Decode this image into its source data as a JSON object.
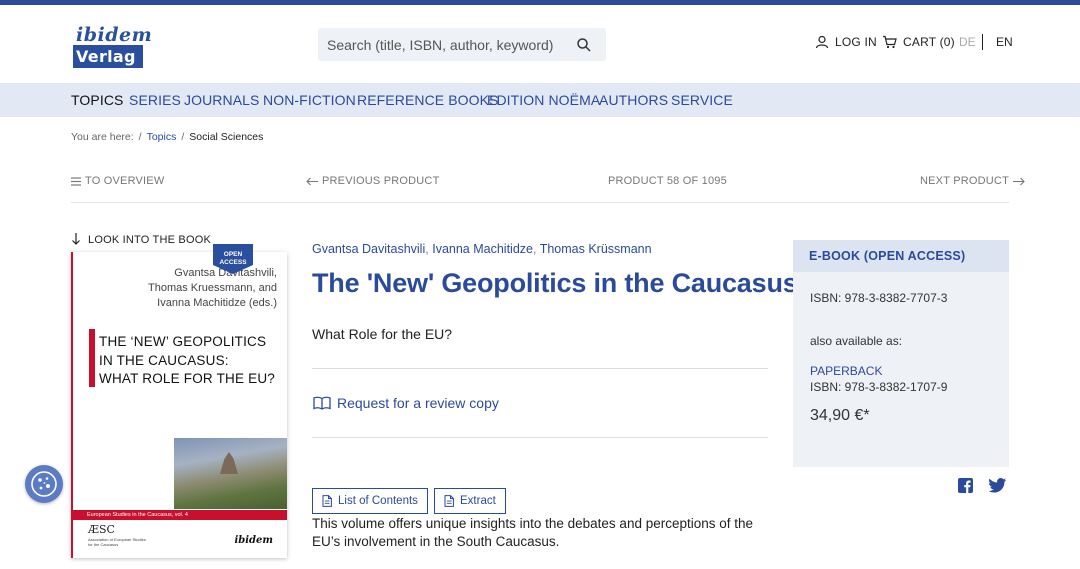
{
  "colors": {
    "brand_blue": "#2b4a9b",
    "nav_bg": "#e3e9f4",
    "accent_red": "#c8102e",
    "box_bg": "#eef1f6"
  },
  "logo": {
    "line1": "ibidem",
    "line2": "Verlag"
  },
  "search": {
    "placeholder": "Search (title, ISBN, author, keyword)",
    "icon": "search-icon"
  },
  "header": {
    "login": "LOG IN",
    "cart": "CART (0)",
    "lang_de": "DE",
    "lang_en": "EN"
  },
  "nav": {
    "items": [
      {
        "label": "TOPICS"
      },
      {
        "label": "SERIES"
      },
      {
        "label": "JOURNALS"
      },
      {
        "label": "NON-FICTION"
      },
      {
        "label": "REFERENCE BOOKS"
      },
      {
        "label": "EDITION NOËMA"
      },
      {
        "label": "AUTHORS"
      },
      {
        "label": "SERVICE"
      }
    ]
  },
  "breadcrumb": {
    "prefix": "You are here:",
    "sep": "/",
    "topics": "Topics",
    "current": "Social Sciences"
  },
  "pager": {
    "overview": "TO OVERVIEW",
    "previous": "PREVIOUS PRODUCT",
    "position": "PRODUCT 58 OF 1095",
    "next": "NEXT PRODUCT"
  },
  "cover": {
    "look_label": "LOOK INTO THE BOOK",
    "badge_line1": "OPEN",
    "badge_line2": "ACCESS",
    "authors_line1": "Gvantsa Davitashvili,",
    "authors_line2": "Thomas Kruessmann, and",
    "authors_line3": "Ivanna Machitidze (eds.)",
    "title_line1": "THE ‘NEW’ GEOPOLITICS",
    "title_line2": "IN THE CAUCASUS:",
    "title_line3": "WHAT ROLE FOR THE EU?",
    "series": "European Studies in the Caucasus, vol. 4",
    "aesc": "ÆSC",
    "aesc_sub": "Association of European Studies for the Caucasus",
    "publisher": "ibidem"
  },
  "product": {
    "author1": "Gvantsa Davitashvili",
    "author2": "Ivanna Machitidze",
    "author3": "Thomas Krüssmann",
    "comma": ",",
    "title": "The 'New' Geopolitics in the Caucasus",
    "subtitle": "What Role for the EU?",
    "review": "Request for a review copy",
    "toc_button": "List of Contents",
    "extract_button": "Extract",
    "description": "This volume offers unique insights into the debates and perceptions of the EU’s involvement in the South Caucasus."
  },
  "edition": {
    "heading": "E-BOOK (OPEN ACCESS)",
    "isbn": "ISBN: 978-3-8382-7707-3",
    "also": "also available as:",
    "paperback": "PAPERBACK",
    "paperback_isbn": "ISBN: 978-3-8382-1707-9",
    "price": "34,90 €*"
  }
}
